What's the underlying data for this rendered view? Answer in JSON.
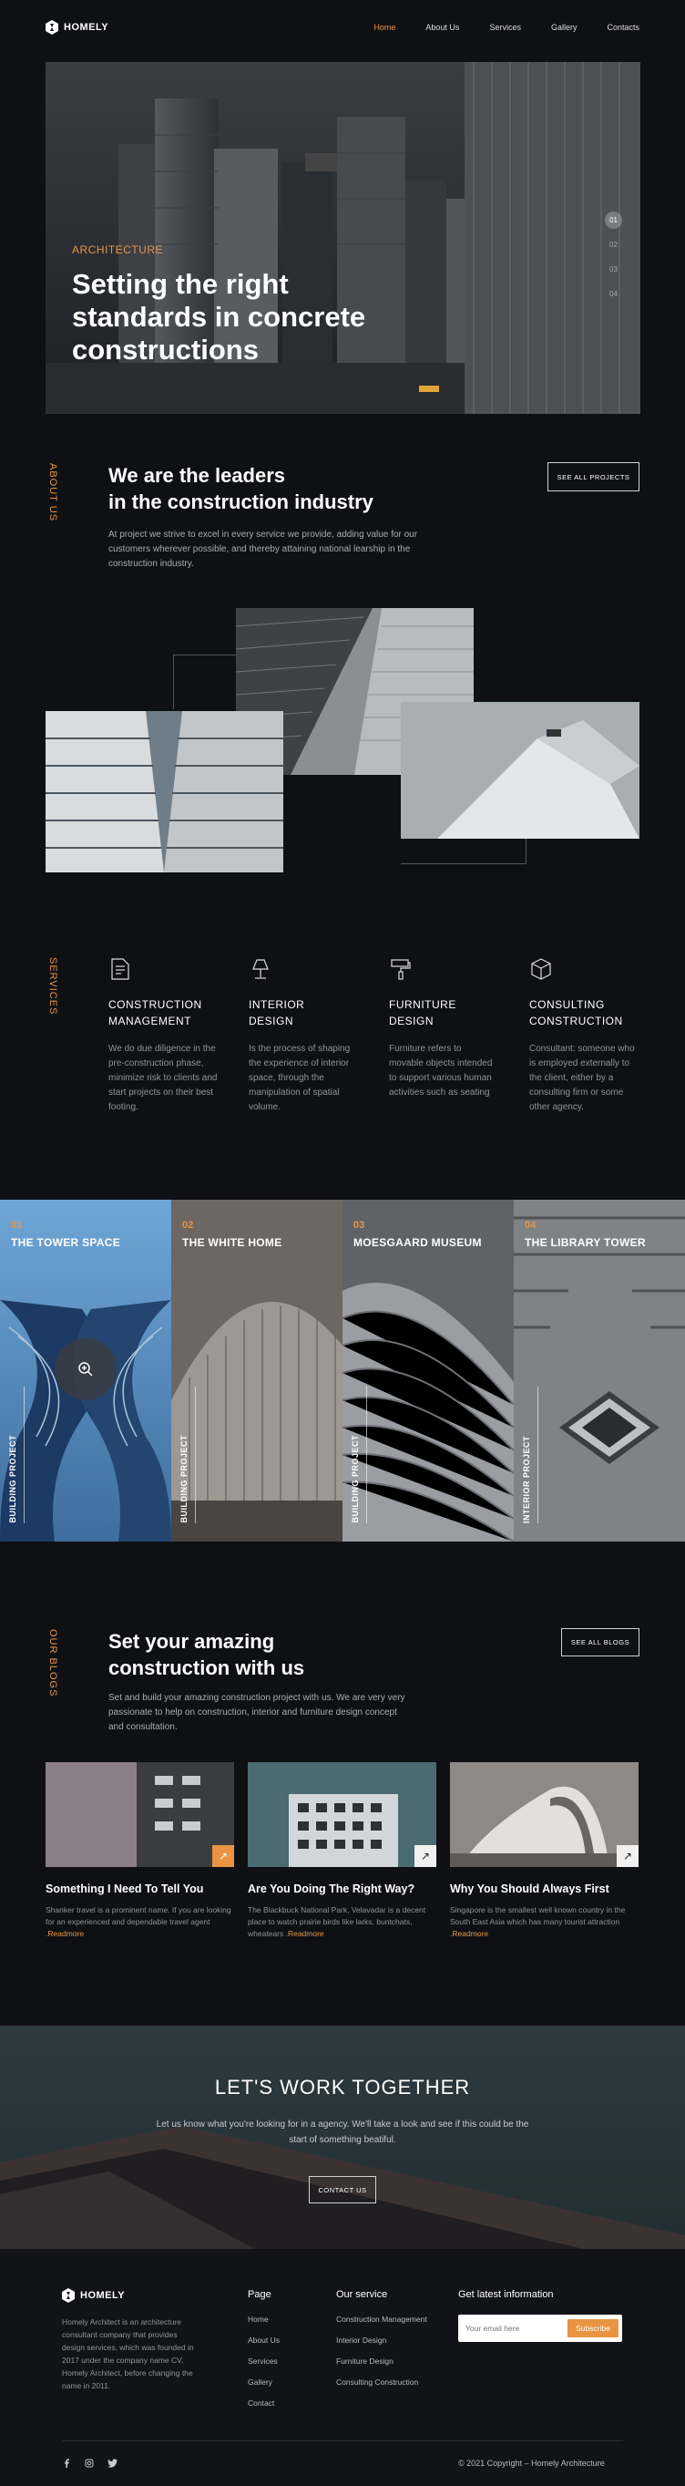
{
  "brand": {
    "name": "HOMELY"
  },
  "nav": {
    "items": [
      {
        "label": "Home",
        "active": true
      },
      {
        "label": "About Us"
      },
      {
        "label": "Services"
      },
      {
        "label": "Gallery"
      },
      {
        "label": "Contacts"
      }
    ]
  },
  "hero": {
    "kicker": "ARCHITECTURE",
    "title": "Setting the right standards in concrete constructions",
    "slides": [
      "01",
      "02",
      "03",
      "04"
    ]
  },
  "about": {
    "vertical_label": "ABOUT US",
    "title_line1": "We are the leaders",
    "title_line2": "in the construction industry",
    "text": "At project we strive to excel in every service we provide, adding value for our customers wherever possible, and thereby attaining national learship in the construction industry.",
    "button": "SEE ALL PROJECTS"
  },
  "services": {
    "vertical_label": "SERVICES",
    "items": [
      {
        "icon": "document-icon",
        "title_line1": "CONSTRUCTION",
        "title_line2": "MANAGEMENT",
        "text": "We do due diligence in the pre-construction phase, minimize risk to clients and start projects on their best footing."
      },
      {
        "icon": "lamp-icon",
        "title_line1": "INTERIOR",
        "title_line2": "DESIGN",
        "text": "Is the process of shaping the experience of interior space, through the manipulation of spatial volume."
      },
      {
        "icon": "paint-roller-icon",
        "title_line1": "FURNITURE",
        "title_line2": "DESIGN",
        "text": "Furniture refers to movable objects intended to support various human activities such as seating"
      },
      {
        "icon": "cube-icon",
        "title_line1": "CONSULTING",
        "title_line2": "CONSTRUCTION",
        "text": "Consultant: someone who is employed externally to the client, either by a consulting firm or some other agency."
      }
    ]
  },
  "projects": [
    {
      "num": "01",
      "title": "THE TOWER SPACE",
      "tag": "BUILDING PROJECT"
    },
    {
      "num": "02",
      "title": "THE WHITE HOME",
      "tag": "BUILDING PROJECT"
    },
    {
      "num": "03",
      "title": "MOESGAARD MUSEUM",
      "tag": "BUILDING PROJECT"
    },
    {
      "num": "04",
      "title": "THE LIBRARY TOWER",
      "tag": "INTERIOR PROJECT"
    }
  ],
  "blogs": {
    "vertical_label": "OUR BLOGS",
    "title_line1": "Set your amazing",
    "title_line2": "construction with us",
    "text": "Set and build your amazing construction project with us. We are very very passionate to help on construction, interior and furniture design concept and consultation.",
    "button": "SEE ALL BLOGS",
    "readmore": "Readmore",
    "posts": [
      {
        "title": "Something I Need To Tell You",
        "text": "Shanker travel is a prominent name. If you are looking for an experienced and dependable travel agent ."
      },
      {
        "title": "Are You Doing The Right Way?",
        "text": "The Blackbuck National Park, Velavadar is a decent place to watch prairie birds like larks, buntchats, wheatears ."
      },
      {
        "title": "Why You Should Always First",
        "text": "Singapore is the smallest well known country in the South East Asia which has many tourist attraction ."
      }
    ]
  },
  "cta": {
    "title": "LET'S WORK TOGETHER",
    "text": "Let us know what you're looking for in a agency. We'll take a look and see if this could be the start of something beatiful.",
    "button": "CONTACT US"
  },
  "footer": {
    "about": "Homely Architect is an architecture consultant company that provides design services, which was founded in 2017 under the company name CV. Homely Architect, before changing the name in 2011.",
    "page_title": "Page",
    "page_links": [
      "Home",
      "About Us",
      "Services",
      "Gallery",
      "Contact"
    ],
    "service_title": "Our service",
    "service_links": [
      "Construction Management",
      "Interior Design",
      "Furniture Design",
      "Consulting Construction"
    ],
    "newsletter_title": "Get latest information",
    "email_placeholder": "Your email here",
    "subscribe": "Subscribe",
    "copyright": "© 2021 Copyright – Homely Architecture"
  },
  "colors": {
    "accent": "#e99443",
    "background": "#0f1014"
  }
}
